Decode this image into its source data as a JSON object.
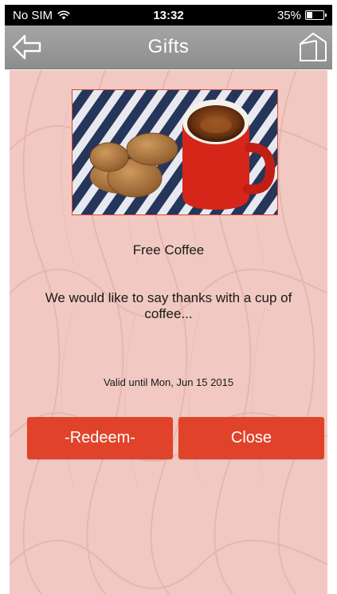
{
  "status_bar": {
    "carrier": "No SIM",
    "time": "13:32",
    "battery_percent": "35%",
    "battery_level": 0.35,
    "wifi_icon": "wifi-icon",
    "battery_icon": "battery-icon"
  },
  "nav": {
    "title": "Gifts",
    "back_icon": "back-arrow-icon",
    "home_icon": "home-icon"
  },
  "gift": {
    "image_icon": "coffee-cookies-photo",
    "title": "Free Coffee",
    "description": "We would like to say thanks with a cup of coffee...",
    "validity": "Valid until Mon, Jun 15 2015"
  },
  "actions": {
    "redeem_label": "-Redeem-",
    "close_label": "Close"
  },
  "colors": {
    "accent": "#e0432a",
    "background": "#f1c9c2",
    "nav_bar": "#999999"
  }
}
